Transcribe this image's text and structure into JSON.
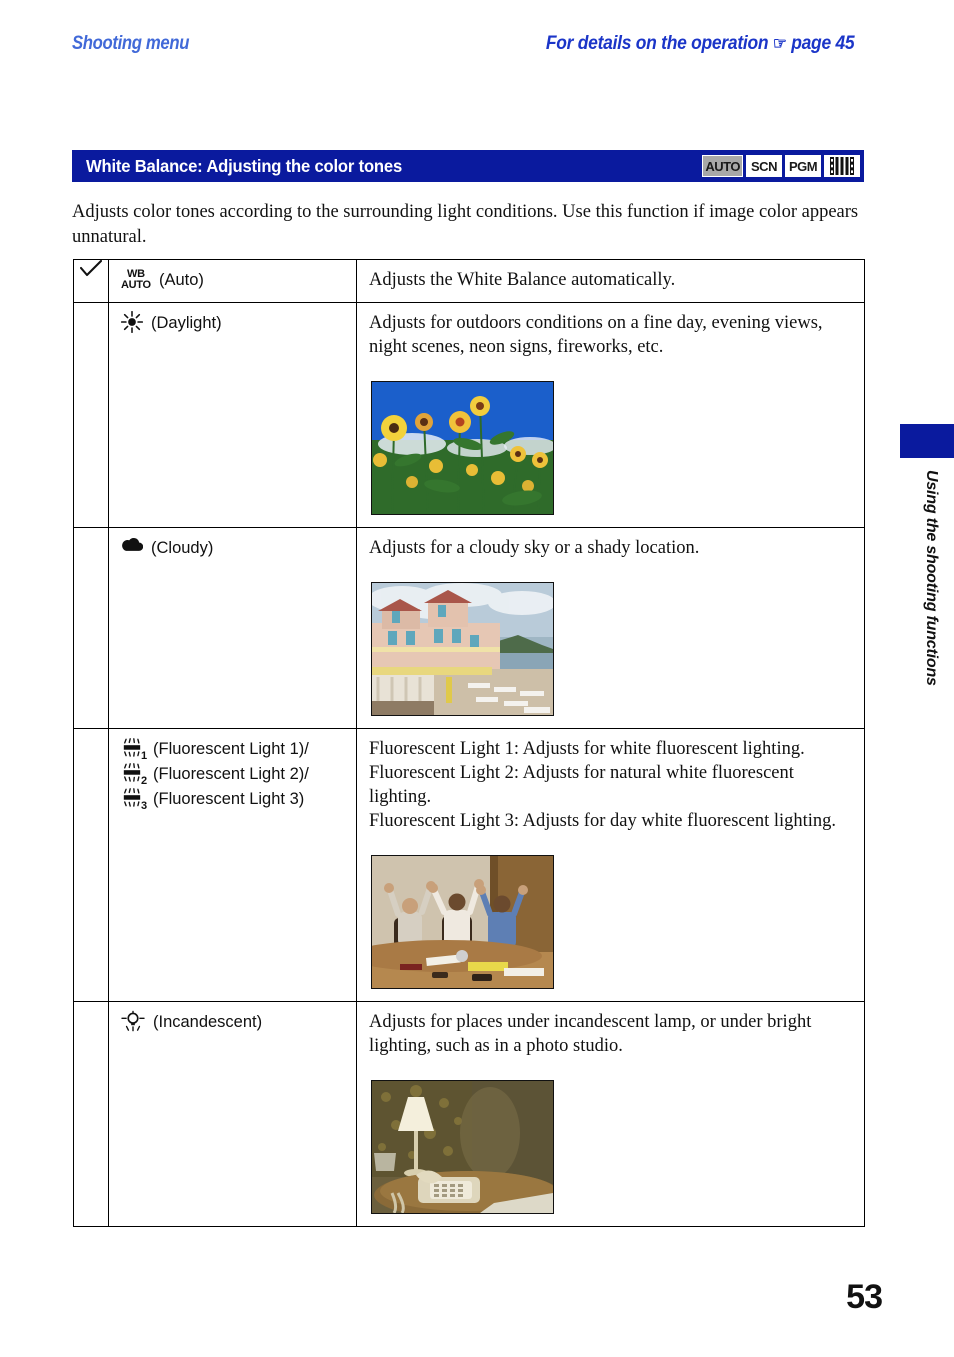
{
  "header": {
    "left_title": "Shooting menu",
    "right_note_before": "For details on the operation",
    "right_note_page": "page 45",
    "hand_icon": "pointing-hand-icon"
  },
  "title_bar": {
    "title": "White Balance: Adjusting the color tones",
    "mode_icons": [
      {
        "label": "AUTO",
        "name": "mode-auto-icon",
        "state": "dimmed"
      },
      {
        "label": "SCN",
        "name": "mode-scn-icon",
        "state": "normal"
      },
      {
        "label": "PGM",
        "name": "mode-pgm-icon",
        "state": "normal"
      },
      {
        "label": "",
        "name": "mode-movie-film-icon",
        "state": "normal"
      }
    ]
  },
  "intro": "Adjusts color tones according to the surrounding light conditions. Use this function if image color appears unnatural.",
  "table": {
    "rows": [
      {
        "default_marked": true,
        "check_icon": "checkmark-icon",
        "icon": "wb-auto-icon",
        "icon_top": "WB",
        "icon_bottom": "AUTO",
        "label": "(Auto)",
        "description": "Adjusts the White Balance automatically.",
        "photo": null
      },
      {
        "default_marked": false,
        "icon": "sun-daylight-icon",
        "label": "(Daylight)",
        "description": "Adjusts for outdoors conditions on a fine day, evening views, night scenes, neon signs, fireworks, etc.",
        "photo": {
          "name": "sample-photo-daylight",
          "alt": "Sunflower field under a deep blue sky"
        }
      },
      {
        "default_marked": false,
        "icon": "cloud-cloudy-icon",
        "label": "(Cloudy)",
        "description": "Adjusts for a cloudy sky or a shady location.",
        "photo": {
          "name": "sample-photo-cloudy",
          "alt": "Pink seaside hotel with terrace under a cloudy sky"
        }
      },
      {
        "default_marked": false,
        "icon": "fluorescent-tube-icon",
        "labels": [
          {
            "icon": "fluorescent-tube-1-icon",
            "sub": "1",
            "text": "(Fluorescent Light 1)/"
          },
          {
            "icon": "fluorescent-tube-2-icon",
            "sub": "2",
            "text": "(Fluorescent Light 2)/"
          },
          {
            "icon": "fluorescent-tube-3-icon",
            "sub": "3",
            "text": "(Fluorescent Light 3)"
          }
        ],
        "description": "Fluorescent Light 1: Adjusts for white fluorescent lighting.\nFluorescent Light 2: Adjusts for natural white fluorescent lighting.\nFluorescent Light 3: Adjusts for day white fluorescent lighting.",
        "photo": {
          "name": "sample-photo-fluorescent",
          "alt": "Three colleagues cheering with raised arms at an office table"
        }
      },
      {
        "default_marked": false,
        "icon": "incandescent-bulb-icon",
        "label": "(Incandescent)",
        "description": "Adjusts for places under incandescent lamp, or under bright lighting, such as in a photo studio.",
        "photo": {
          "name": "sample-photo-incandescent",
          "alt": "Bedside table with lit lamp and telephone in warm light"
        }
      }
    ]
  },
  "side_tab": {
    "text": "Using the shooting functions"
  },
  "page_number": "53",
  "colors": {
    "brand_blue": "#0a1a9e",
    "header_blue": "#4169d8",
    "link_blue": "#1b35c8",
    "dim_chip": "#a8a8a8"
  }
}
